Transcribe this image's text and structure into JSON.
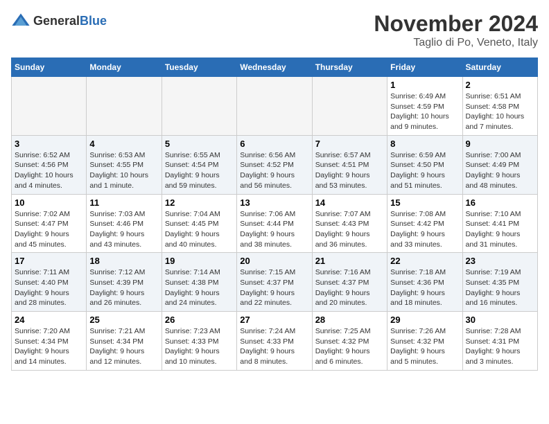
{
  "logo": {
    "text_general": "General",
    "text_blue": "Blue"
  },
  "title": {
    "month": "November 2024",
    "location": "Taglio di Po, Veneto, Italy"
  },
  "weekdays": [
    "Sunday",
    "Monday",
    "Tuesday",
    "Wednesday",
    "Thursday",
    "Friday",
    "Saturday"
  ],
  "weeks": [
    [
      {
        "day": "",
        "info": ""
      },
      {
        "day": "",
        "info": ""
      },
      {
        "day": "",
        "info": ""
      },
      {
        "day": "",
        "info": ""
      },
      {
        "day": "",
        "info": ""
      },
      {
        "day": "1",
        "info": "Sunrise: 6:49 AM\nSunset: 4:59 PM\nDaylight: 10 hours\nand 9 minutes."
      },
      {
        "day": "2",
        "info": "Sunrise: 6:51 AM\nSunset: 4:58 PM\nDaylight: 10 hours\nand 7 minutes."
      }
    ],
    [
      {
        "day": "3",
        "info": "Sunrise: 6:52 AM\nSunset: 4:56 PM\nDaylight: 10 hours\nand 4 minutes."
      },
      {
        "day": "4",
        "info": "Sunrise: 6:53 AM\nSunset: 4:55 PM\nDaylight: 10 hours\nand 1 minute."
      },
      {
        "day": "5",
        "info": "Sunrise: 6:55 AM\nSunset: 4:54 PM\nDaylight: 9 hours\nand 59 minutes."
      },
      {
        "day": "6",
        "info": "Sunrise: 6:56 AM\nSunset: 4:52 PM\nDaylight: 9 hours\nand 56 minutes."
      },
      {
        "day": "7",
        "info": "Sunrise: 6:57 AM\nSunset: 4:51 PM\nDaylight: 9 hours\nand 53 minutes."
      },
      {
        "day": "8",
        "info": "Sunrise: 6:59 AM\nSunset: 4:50 PM\nDaylight: 9 hours\nand 51 minutes."
      },
      {
        "day": "9",
        "info": "Sunrise: 7:00 AM\nSunset: 4:49 PM\nDaylight: 9 hours\nand 48 minutes."
      }
    ],
    [
      {
        "day": "10",
        "info": "Sunrise: 7:02 AM\nSunset: 4:47 PM\nDaylight: 9 hours\nand 45 minutes."
      },
      {
        "day": "11",
        "info": "Sunrise: 7:03 AM\nSunset: 4:46 PM\nDaylight: 9 hours\nand 43 minutes."
      },
      {
        "day": "12",
        "info": "Sunrise: 7:04 AM\nSunset: 4:45 PM\nDaylight: 9 hours\nand 40 minutes."
      },
      {
        "day": "13",
        "info": "Sunrise: 7:06 AM\nSunset: 4:44 PM\nDaylight: 9 hours\nand 38 minutes."
      },
      {
        "day": "14",
        "info": "Sunrise: 7:07 AM\nSunset: 4:43 PM\nDaylight: 9 hours\nand 36 minutes."
      },
      {
        "day": "15",
        "info": "Sunrise: 7:08 AM\nSunset: 4:42 PM\nDaylight: 9 hours\nand 33 minutes."
      },
      {
        "day": "16",
        "info": "Sunrise: 7:10 AM\nSunset: 4:41 PM\nDaylight: 9 hours\nand 31 minutes."
      }
    ],
    [
      {
        "day": "17",
        "info": "Sunrise: 7:11 AM\nSunset: 4:40 PM\nDaylight: 9 hours\nand 28 minutes."
      },
      {
        "day": "18",
        "info": "Sunrise: 7:12 AM\nSunset: 4:39 PM\nDaylight: 9 hours\nand 26 minutes."
      },
      {
        "day": "19",
        "info": "Sunrise: 7:14 AM\nSunset: 4:38 PM\nDaylight: 9 hours\nand 24 minutes."
      },
      {
        "day": "20",
        "info": "Sunrise: 7:15 AM\nSunset: 4:37 PM\nDaylight: 9 hours\nand 22 minutes."
      },
      {
        "day": "21",
        "info": "Sunrise: 7:16 AM\nSunset: 4:37 PM\nDaylight: 9 hours\nand 20 minutes."
      },
      {
        "day": "22",
        "info": "Sunrise: 7:18 AM\nSunset: 4:36 PM\nDaylight: 9 hours\nand 18 minutes."
      },
      {
        "day": "23",
        "info": "Sunrise: 7:19 AM\nSunset: 4:35 PM\nDaylight: 9 hours\nand 16 minutes."
      }
    ],
    [
      {
        "day": "24",
        "info": "Sunrise: 7:20 AM\nSunset: 4:34 PM\nDaylight: 9 hours\nand 14 minutes."
      },
      {
        "day": "25",
        "info": "Sunrise: 7:21 AM\nSunset: 4:34 PM\nDaylight: 9 hours\nand 12 minutes."
      },
      {
        "day": "26",
        "info": "Sunrise: 7:23 AM\nSunset: 4:33 PM\nDaylight: 9 hours\nand 10 minutes."
      },
      {
        "day": "27",
        "info": "Sunrise: 7:24 AM\nSunset: 4:33 PM\nDaylight: 9 hours\nand 8 minutes."
      },
      {
        "day": "28",
        "info": "Sunrise: 7:25 AM\nSunset: 4:32 PM\nDaylight: 9 hours\nand 6 minutes."
      },
      {
        "day": "29",
        "info": "Sunrise: 7:26 AM\nSunset: 4:32 PM\nDaylight: 9 hours\nand 5 minutes."
      },
      {
        "day": "30",
        "info": "Sunrise: 7:28 AM\nSunset: 4:31 PM\nDaylight: 9 hours\nand 3 minutes."
      }
    ]
  ]
}
